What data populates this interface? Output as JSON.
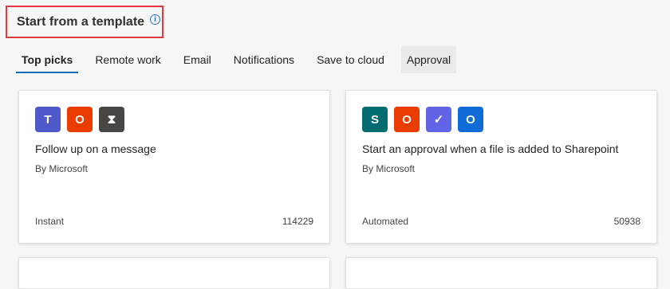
{
  "header": {
    "title": "Start from a template",
    "info_glyph": "i"
  },
  "tabs": [
    {
      "label": "Top picks"
    },
    {
      "label": "Remote work"
    },
    {
      "label": "Email"
    },
    {
      "label": "Notifications"
    },
    {
      "label": "Save to cloud"
    },
    {
      "label": "Approval"
    }
  ],
  "cards": [
    {
      "title": "Follow up on a message",
      "author": "By Microsoft",
      "type": "Instant",
      "count": "114229",
      "icons": [
        {
          "name": "teams-icon",
          "glyph": "T",
          "color": "#5059c9"
        },
        {
          "name": "office-icon",
          "glyph": "O",
          "color": "#eb3c00"
        },
        {
          "name": "hourglass-icon",
          "glyph": "⧗",
          "color": "#484644"
        }
      ]
    },
    {
      "title": "Start an approval when a file is added to Sharepoint",
      "author": "By Microsoft",
      "type": "Automated",
      "count": "50938",
      "icons": [
        {
          "name": "sharepoint-icon",
          "glyph": "S",
          "color": "#036c70"
        },
        {
          "name": "office-icon",
          "glyph": "O",
          "color": "#eb3c00"
        },
        {
          "name": "approvals-icon",
          "glyph": "✓",
          "color": "#6264e8"
        },
        {
          "name": "outlook-icon",
          "glyph": "O",
          "color": "#0f6cd6"
        }
      ]
    }
  ]
}
